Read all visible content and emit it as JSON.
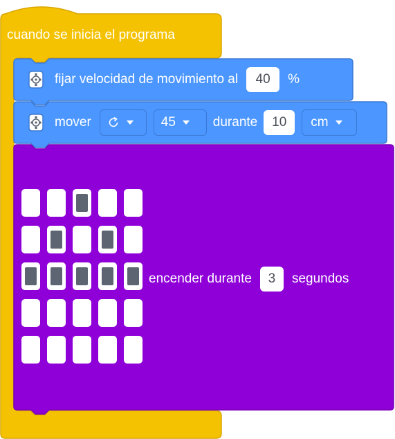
{
  "event": {
    "label": "cuando se inicia el programa",
    "color": "#f4c200",
    "border": "#d9a600"
  },
  "speed_block": {
    "label": "fijar velocidad de movimiento al",
    "value": "40",
    "unit": "%",
    "icon": "motor-pair-icon",
    "color": "#4c97ff"
  },
  "move_block": {
    "label": "mover",
    "direction_icon": "rotate-clockwise-icon",
    "angle": "45",
    "during_label": "durante",
    "distance": "10",
    "unit": "cm",
    "icon": "motor-pair-icon",
    "color": "#4c97ff"
  },
  "light_block": {
    "pattern": [
      [
        0,
        0,
        1,
        0,
        0
      ],
      [
        0,
        1,
        0,
        1,
        0
      ],
      [
        1,
        1,
        1,
        1,
        1
      ],
      [
        0,
        0,
        0,
        0,
        0
      ],
      [
        0,
        0,
        0,
        0,
        0
      ]
    ],
    "label": "encender durante",
    "seconds": "3",
    "unit_label": "segundos",
    "color": "#8f00d8",
    "border": "#7a00b8"
  }
}
